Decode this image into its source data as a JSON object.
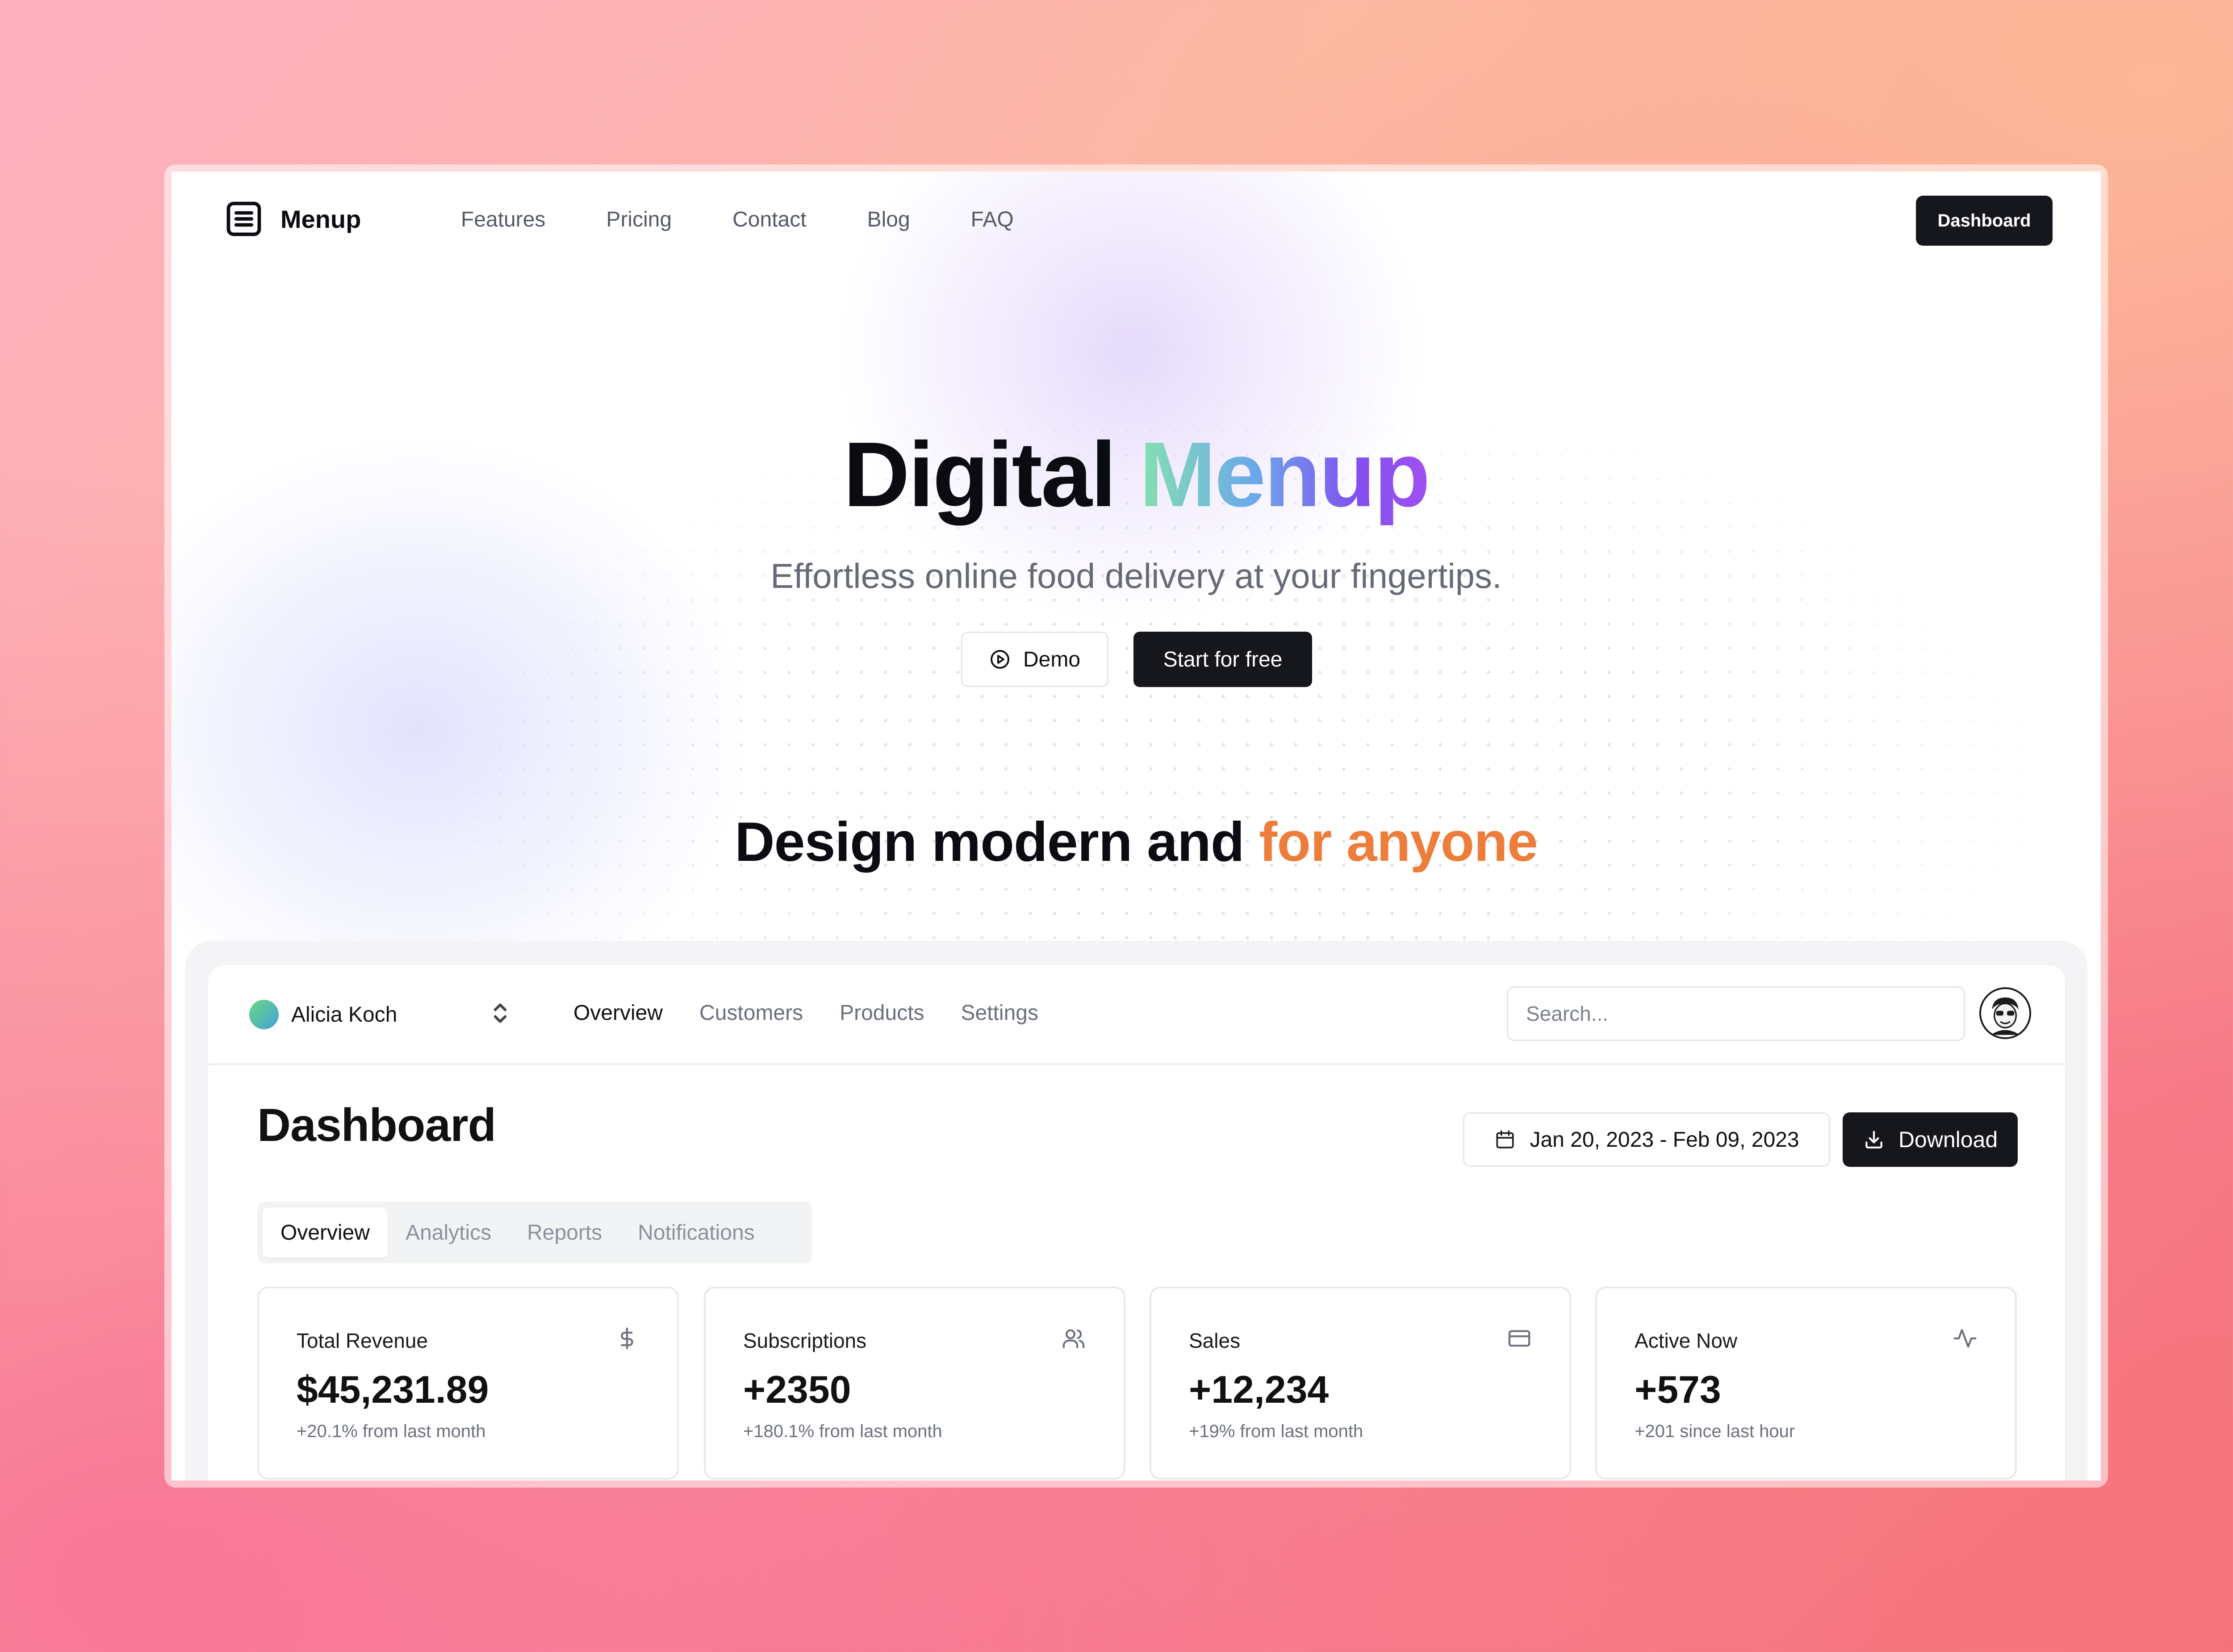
{
  "brand": {
    "name": "Menup"
  },
  "nav": {
    "links": [
      "Features",
      "Pricing",
      "Contact",
      "Blog",
      "FAQ"
    ],
    "dashboard_label": "Dashboard"
  },
  "hero": {
    "title_plain": "Digital",
    "title_gradient": "Menup",
    "subtitle": "Effortless online food delivery at your fingertips.",
    "demo_label": "Demo",
    "start_label": "Start for free"
  },
  "section": {
    "heading_plain": "Design modern and",
    "heading_accent": "for anyone"
  },
  "dashboard": {
    "team_name": "Alicia Koch",
    "nav": [
      "Overview",
      "Customers",
      "Products",
      "Settings"
    ],
    "active_nav": "Overview",
    "search_placeholder": "Search...",
    "heading": "Dashboard",
    "date_range": "Jan 20, 2023 - Feb 09, 2023",
    "download_label": "Download",
    "tabs": [
      "Overview",
      "Analytics",
      "Reports",
      "Notifications"
    ],
    "active_tab": "Overview",
    "stats": [
      {
        "title": "Total Revenue",
        "value": "$45,231.89",
        "sub": "+20.1% from last month",
        "icon": "dollar-icon"
      },
      {
        "title": "Subscriptions",
        "value": "+2350",
        "sub": "+180.1% from last month",
        "icon": "users-icon"
      },
      {
        "title": "Sales",
        "value": "+12,234",
        "sub": "+19% from last month",
        "icon": "credit-card-icon"
      },
      {
        "title": "Active Now",
        "value": "+573",
        "sub": "+201 since last hour",
        "icon": "activity-icon"
      }
    ]
  },
  "colors": {
    "accent_orange": "#ed7d3a",
    "button_dark": "#16161d",
    "gradient": [
      "#86e0b0",
      "#6aa8ea",
      "#8150f0"
    ]
  }
}
